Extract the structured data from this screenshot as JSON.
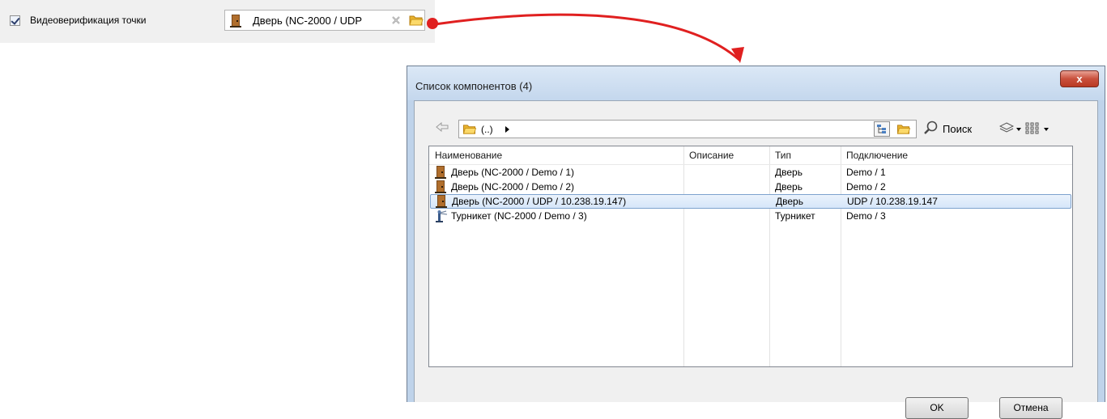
{
  "top": {
    "checkbox_label": "Видеоверификация точки",
    "checked": true,
    "field_value": "Дверь (NC-2000 / UDP"
  },
  "dialog": {
    "title": "Список компонентов (4)",
    "close_label": "x",
    "path": "(..)",
    "search_label": "Поиск",
    "columns": [
      "Наименование",
      "Описание",
      "Тип",
      "Подключение"
    ],
    "rows": [
      {
        "icon": "door-icon",
        "name": "Дверь (NC-2000 / Demo / 1)",
        "description": "",
        "type": "Дверь",
        "connection": "Demo / 1",
        "selected": false
      },
      {
        "icon": "door-icon",
        "name": "Дверь (NC-2000 / Demo / 2)",
        "description": "",
        "type": "Дверь",
        "connection": "Demo / 2",
        "selected": false
      },
      {
        "icon": "door-icon",
        "name": "Дверь (NC-2000 / UDP / 10.238.19.147)",
        "description": "",
        "type": "Дверь",
        "connection": "UDP / 10.238.19.147",
        "selected": true
      },
      {
        "icon": "turnstile-icon",
        "name": "Турникет (NC-2000 / Demo / 3)",
        "description": "",
        "type": "Турникет",
        "connection": "Demo / 3",
        "selected": false
      }
    ],
    "ok_label": "OK",
    "cancel_label": "Отмена"
  },
  "colors": {
    "arrow": "#e02020",
    "selection": "#d6e6f9",
    "title_bar": "#c4d7ed",
    "close_button": "#c9503c"
  }
}
